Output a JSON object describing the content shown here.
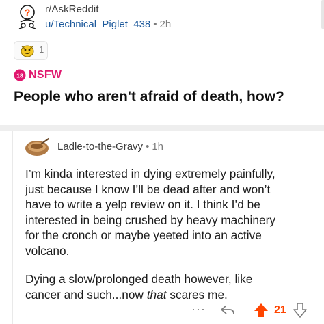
{
  "post": {
    "subreddit": "r/AskReddit",
    "author": "u/Technical_Piglet_438",
    "separator": "•",
    "time": "2h",
    "award_count": "1",
    "nsfw_label": "NSFW",
    "nsfw_badge": "18",
    "title": "People who aren't afraid of death, how?"
  },
  "comment": {
    "author": "Ladle-to-the-Gravy",
    "separator": "•",
    "time": "1h",
    "paragraph1_lines": [
      "I’m kinda interested in dying extremely painfully,",
      "just because I know I’ll be dead after and won’t",
      "have to write a yelp review on it. I think I’d be",
      "interested in being crushed by heavy machinery",
      "for the cronch or maybe yeeted into an active",
      "volcano."
    ],
    "paragraph2_line1": "Dying a slow/prolonged death however, like",
    "paragraph2_line2_pre": "cancer and such...now ",
    "paragraph2_line2_em": "that",
    "paragraph2_line2_post": " scares me.",
    "more_label": "···",
    "vote_count": "21"
  },
  "colors": {
    "nsfw": "#e0176e",
    "upvote": "#ff4500",
    "link": "#1e5a9c"
  }
}
